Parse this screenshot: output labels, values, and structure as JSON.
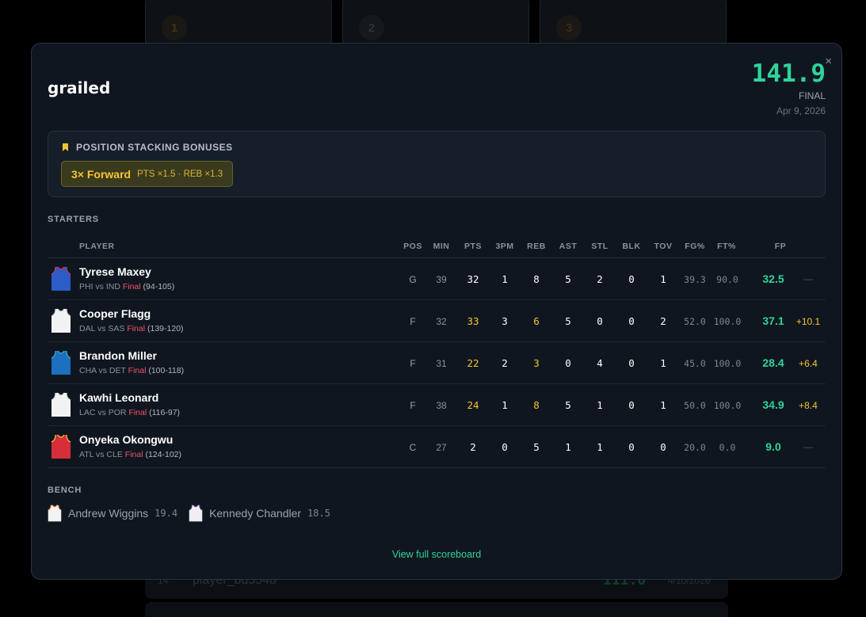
{
  "background": {
    "ranks": [
      "1",
      "2",
      "3"
    ],
    "rows": [
      {
        "num": "14",
        "name": "player_bd554b",
        "score": "111.0",
        "date": "4/10/2026"
      },
      {
        "num": "15",
        "name": "",
        "score": "",
        "date": ""
      }
    ]
  },
  "modal": {
    "title": "grailed",
    "score": "141.9",
    "status": "FINAL",
    "date": "Apr 9, 2026",
    "close_label": "×"
  },
  "bonus": {
    "header": "POSITION STACKING BONUSES",
    "chip_name": "3× Forward",
    "chip_detail": "PTS ×1.5 · REB ×1.3"
  },
  "starters_label": "STARTERS",
  "columns": {
    "player": "PLAYER",
    "pos": "POS",
    "min": "MIN",
    "pts": "PTS",
    "tpm": "3PM",
    "reb": "REB",
    "ast": "AST",
    "stl": "STL",
    "blk": "BLK",
    "tov": "TOV",
    "fgp": "FG%",
    "ftp": "FT%",
    "fp": "FP"
  },
  "players": [
    {
      "name": "Tyrese Maxey",
      "matchup": "PHI vs IND",
      "status": "Final",
      "result": "(94-105)",
      "pos": "G",
      "min": "39",
      "pts": "32",
      "tpm": "1",
      "reb": "8",
      "ast": "5",
      "stl": "2",
      "blk": "0",
      "tov": "1",
      "fgp": "39.3",
      "ftp": "90.0",
      "fp": "32.5",
      "bonus": "—",
      "jersey": "#2b5cc8",
      "trim": "#d8324a"
    },
    {
      "name": "Cooper Flagg",
      "matchup": "DAL vs SAS",
      "status": "Final",
      "result": "(139-120)",
      "pos": "F",
      "min": "32",
      "pts": "33",
      "tpm": "3",
      "reb": "6",
      "ast": "5",
      "stl": "0",
      "blk": "0",
      "tov": "2",
      "fgp": "52.0",
      "ftp": "100.0",
      "fp": "37.1",
      "bonus": "+10.1",
      "jersey": "#f2f2f2",
      "trim": "#c9ccd2"
    },
    {
      "name": "Brandon Miller",
      "matchup": "CHA vs DET",
      "status": "Final",
      "result": "(100-118)",
      "pos": "F",
      "min": "31",
      "pts": "22",
      "tpm": "2",
      "reb": "3",
      "ast": "0",
      "stl": "4",
      "blk": "0",
      "tov": "1",
      "fgp": "45.0",
      "ftp": "100.0",
      "fp": "28.4",
      "bonus": "+6.4",
      "jersey": "#1d6fc0",
      "trim": "#2fb0c8"
    },
    {
      "name": "Kawhi Leonard",
      "matchup": "LAC vs POR",
      "status": "Final",
      "result": "(116-97)",
      "pos": "F",
      "min": "38",
      "pts": "24",
      "tpm": "1",
      "reb": "8",
      "ast": "5",
      "stl": "1",
      "blk": "0",
      "tov": "1",
      "fgp": "50.0",
      "ftp": "100.0",
      "fp": "34.9",
      "bonus": "+8.4",
      "jersey": "#f2f2f2",
      "trim": "#d0d3d8"
    },
    {
      "name": "Onyeka Okongwu",
      "matchup": "ATL vs CLE",
      "status": "Final",
      "result": "(124-102)",
      "pos": "C",
      "min": "27",
      "pts": "2",
      "tpm": "0",
      "reb": "5",
      "ast": "1",
      "stl": "1",
      "blk": "0",
      "tov": "0",
      "fgp": "20.0",
      "ftp": "0.0",
      "fp": "9.0",
      "bonus": "—",
      "jersey": "#d82e3a",
      "trim": "#f0c23a"
    }
  ],
  "bench_label": "BENCH",
  "bench": [
    {
      "name": "Andrew Wiggins",
      "fp": "19.4",
      "jersey": "#f2f2f2",
      "trim": "#e07a3a"
    },
    {
      "name": "Kennedy Chandler",
      "fp": "18.5",
      "jersey": "#efeef5",
      "trim": "#5a3d9a"
    }
  ],
  "link_label": "View full scoreboard"
}
